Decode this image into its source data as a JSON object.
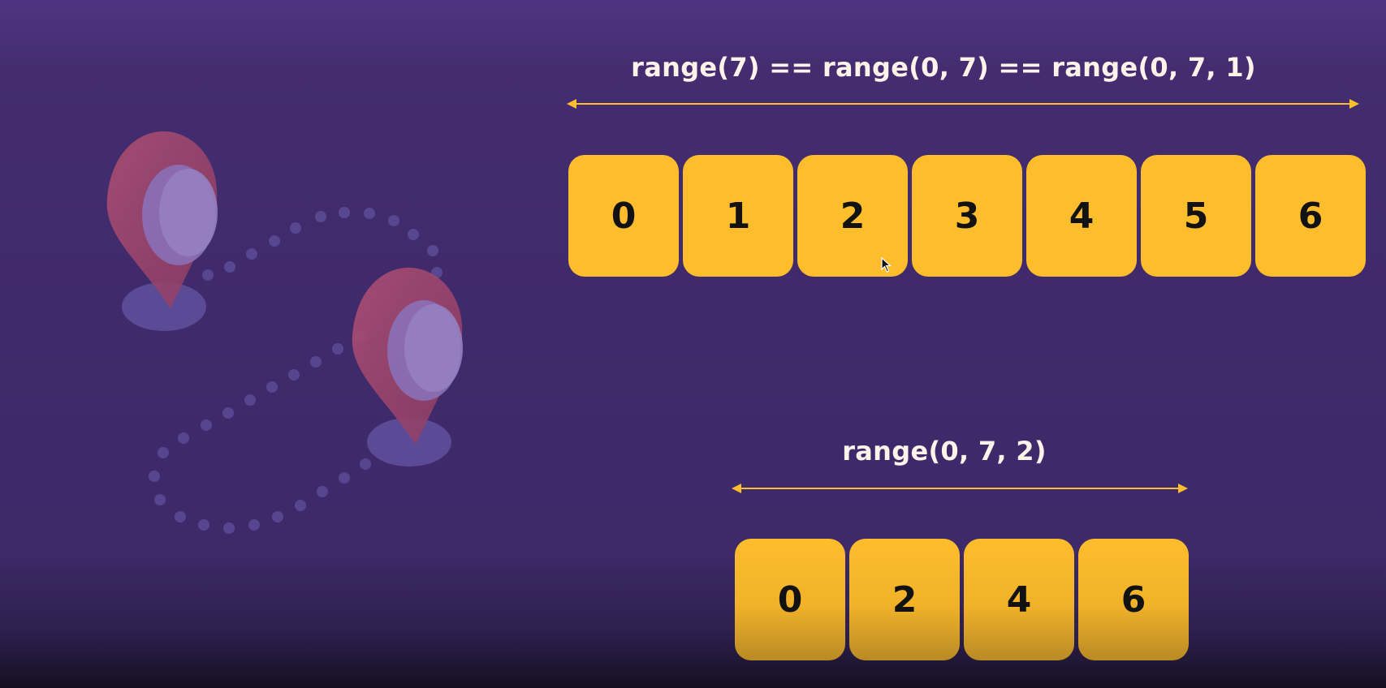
{
  "diagram": {
    "top": {
      "title": "range(7) == range(0, 7) == range(0, 7, 1)",
      "values": [
        "0",
        "1",
        "2",
        "3",
        "4",
        "5",
        "6"
      ]
    },
    "bottom": {
      "title": "range(0, 7, 2)",
      "values": [
        "0",
        "2",
        "4",
        "6"
      ]
    }
  },
  "colors": {
    "accent": "#fdbd2c",
    "background": "#3f2a6b",
    "pin": "#a0486d",
    "text": "#fff3ea"
  },
  "icons": [
    "location-pin-icon",
    "location-pin-icon",
    "mouse-cursor-icon"
  ]
}
